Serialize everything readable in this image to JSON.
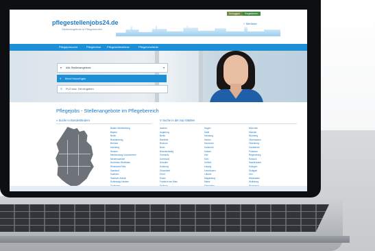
{
  "site": {
    "logo": "pflegestellenjobs24.de",
    "logo_sub": "Stellenangebote in Pflegeberufen",
    "login_label": "Einloggen",
    "register_label": "Registrieren",
    "merkliste": "☆ Merkliste"
  },
  "nav": {
    "items": [
      "Pflegejobsuche",
      "Pflegebörse",
      "Pflegestellenbörse",
      "Pflegeberufsinfo"
    ]
  },
  "search": {
    "category_placeholder": "Alle Stellenangebote",
    "beruf_label": "Beruf hinzufügen",
    "plz_placeholder": "PLZ bzw. Ort eingeben"
  },
  "main": {
    "title": "Pflegejobs - Stellenangebote im Pflegebereich",
    "bundesland_heading": "Suche in Bundesländern",
    "staedte_heading": "Suche in den top Städten"
  },
  "bundeslaender": [
    "Baden-Württemberg",
    "Bayern",
    "Berlin",
    "Brandenburg",
    "Bremen",
    "Hamburg",
    "Hessen",
    "Mecklenburg-Vorpommern",
    "Niedersachsen",
    "Nordrhein-Westfalen",
    "Rheinland-Pfalz",
    "Saarland",
    "Sachsen",
    "Sachsen-Anhalt",
    "Schleswig-Holstein",
    "Thüringen"
  ],
  "staedte_col1": [
    "Aachen",
    "Augsburg",
    "Berlin",
    "Bielefeld",
    "Bochum",
    "Bonn",
    "Braunschweig",
    "Chemnitz",
    "Dortmund",
    "Dresden",
    "Duisburg",
    "Düsseldorf",
    "Erfurt",
    "Essen",
    "Frankfurt am Main",
    "Freiburg",
    "Gelsenkirchen"
  ],
  "staedte_col2": [
    "Hagen",
    "Halle",
    "Hamburg",
    "Hamm",
    "Hannover",
    "Karlsruhe",
    "Kassel",
    "Kiel",
    "Köln",
    "Krefeld",
    "Leipzig",
    "Leverkusen",
    "Lübeck",
    "Magdeburg",
    "Mainz",
    "Mannheim",
    "Mönchengladbach"
  ],
  "staedte_col3": [
    "München",
    "Münster",
    "Nürnberg",
    "Oberhausen",
    "Oldenburg",
    "Osnabrück",
    "Potsdam",
    "Regensburg",
    "Rostock",
    "Saarbrücken",
    "Solingen",
    "Stuttgart",
    "Ulm",
    "Wiesbaden",
    "Wolfsburg",
    "Wuppertal",
    "Würzburg"
  ]
}
